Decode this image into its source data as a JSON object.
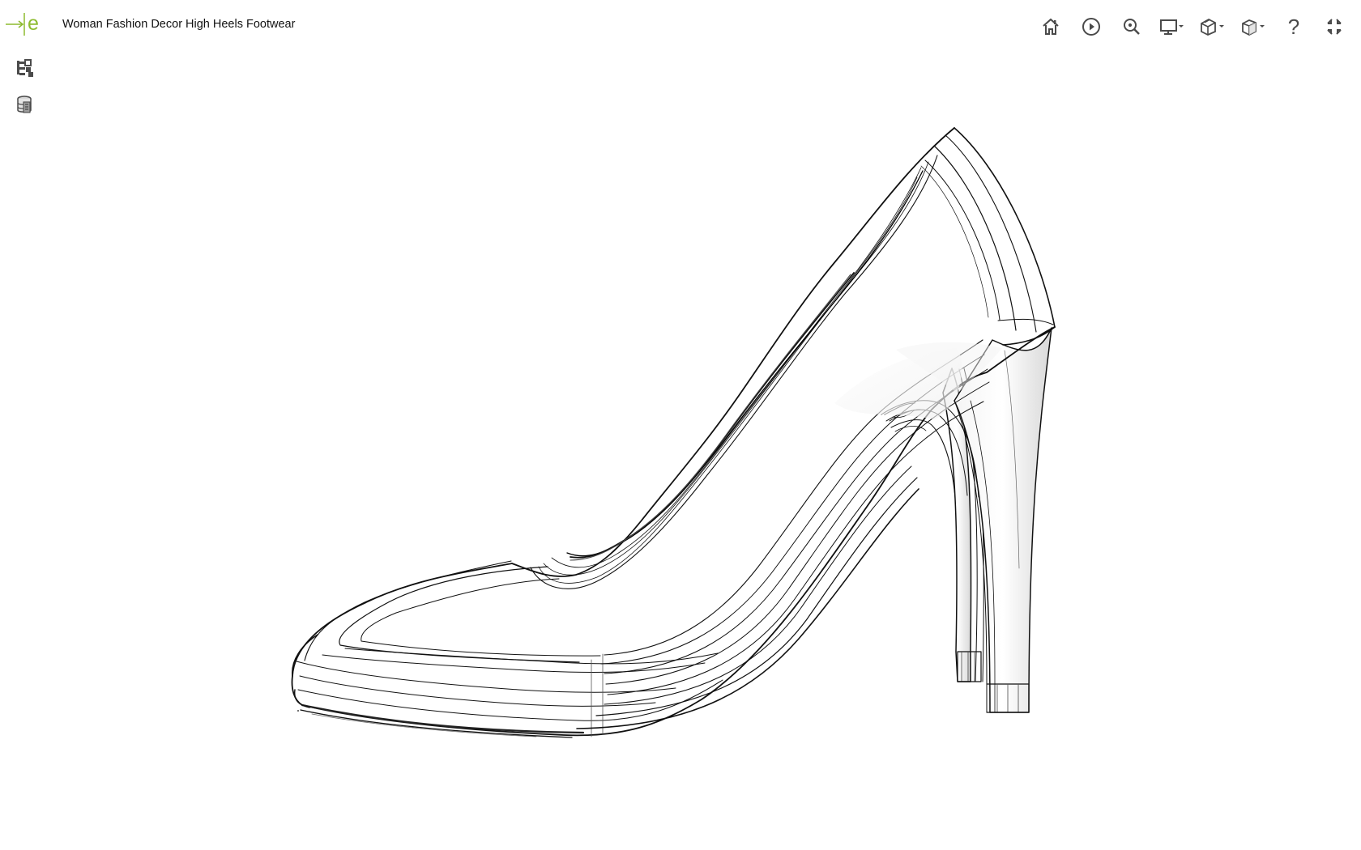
{
  "app": {
    "title": "Woman Fashion Decor High Heels Footwear",
    "accent": "#8dbb2f"
  },
  "toolbar": {
    "items": [
      {
        "icon": "home-icon"
      },
      {
        "icon": "play-icon"
      },
      {
        "icon": "zoom-icon"
      },
      {
        "icon": "display-icon",
        "dropdown": true
      },
      {
        "icon": "view-icon",
        "dropdown": true
      },
      {
        "icon": "cube-icon",
        "dropdown": true
      },
      {
        "icon": "help-icon",
        "label": "?"
      },
      {
        "icon": "fullscreen-icon"
      }
    ]
  },
  "sidebar": {
    "items": [
      {
        "icon": "model-tree-icon"
      },
      {
        "icon": "database-icon"
      }
    ]
  }
}
